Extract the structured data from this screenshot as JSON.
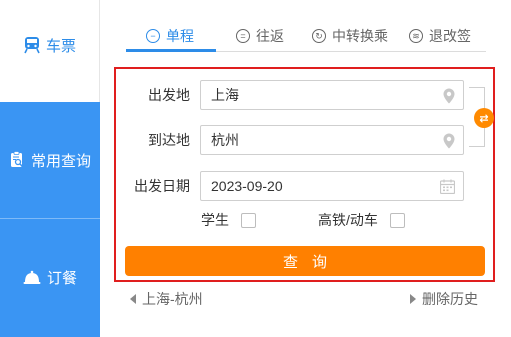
{
  "sidebar": {
    "items": [
      {
        "label": "车票",
        "icon": "train-icon"
      },
      {
        "label": "常用查询",
        "icon": "clipboard-search-icon"
      },
      {
        "label": "订餐",
        "icon": "meal-bell-icon"
      }
    ]
  },
  "tabs": [
    {
      "label": "单程",
      "icon": "one-way-icon",
      "active": true
    },
    {
      "label": "往返",
      "icon": "round-trip-icon"
    },
    {
      "label": "中转换乘",
      "icon": "transfer-icon"
    },
    {
      "label": "退改签",
      "icon": "refund-icon"
    }
  ],
  "form": {
    "departure_label": "出发地",
    "departure_value": "上海",
    "arrival_label": "到达地",
    "arrival_value": "杭州",
    "date_label": "出发日期",
    "date_value": "2023-09-20",
    "student_label": "学生",
    "highspeed_label": "高铁/动车",
    "swap_glyph": "⇄"
  },
  "search_button": "查询",
  "history": {
    "recent": "上海-杭州",
    "clear": "删除历史"
  },
  "colors": {
    "accent_blue": "#2d8ce8",
    "sidebar_blue": "#3a95f3",
    "orange": "#ff8000",
    "highlight_red": "#e01e1e"
  }
}
